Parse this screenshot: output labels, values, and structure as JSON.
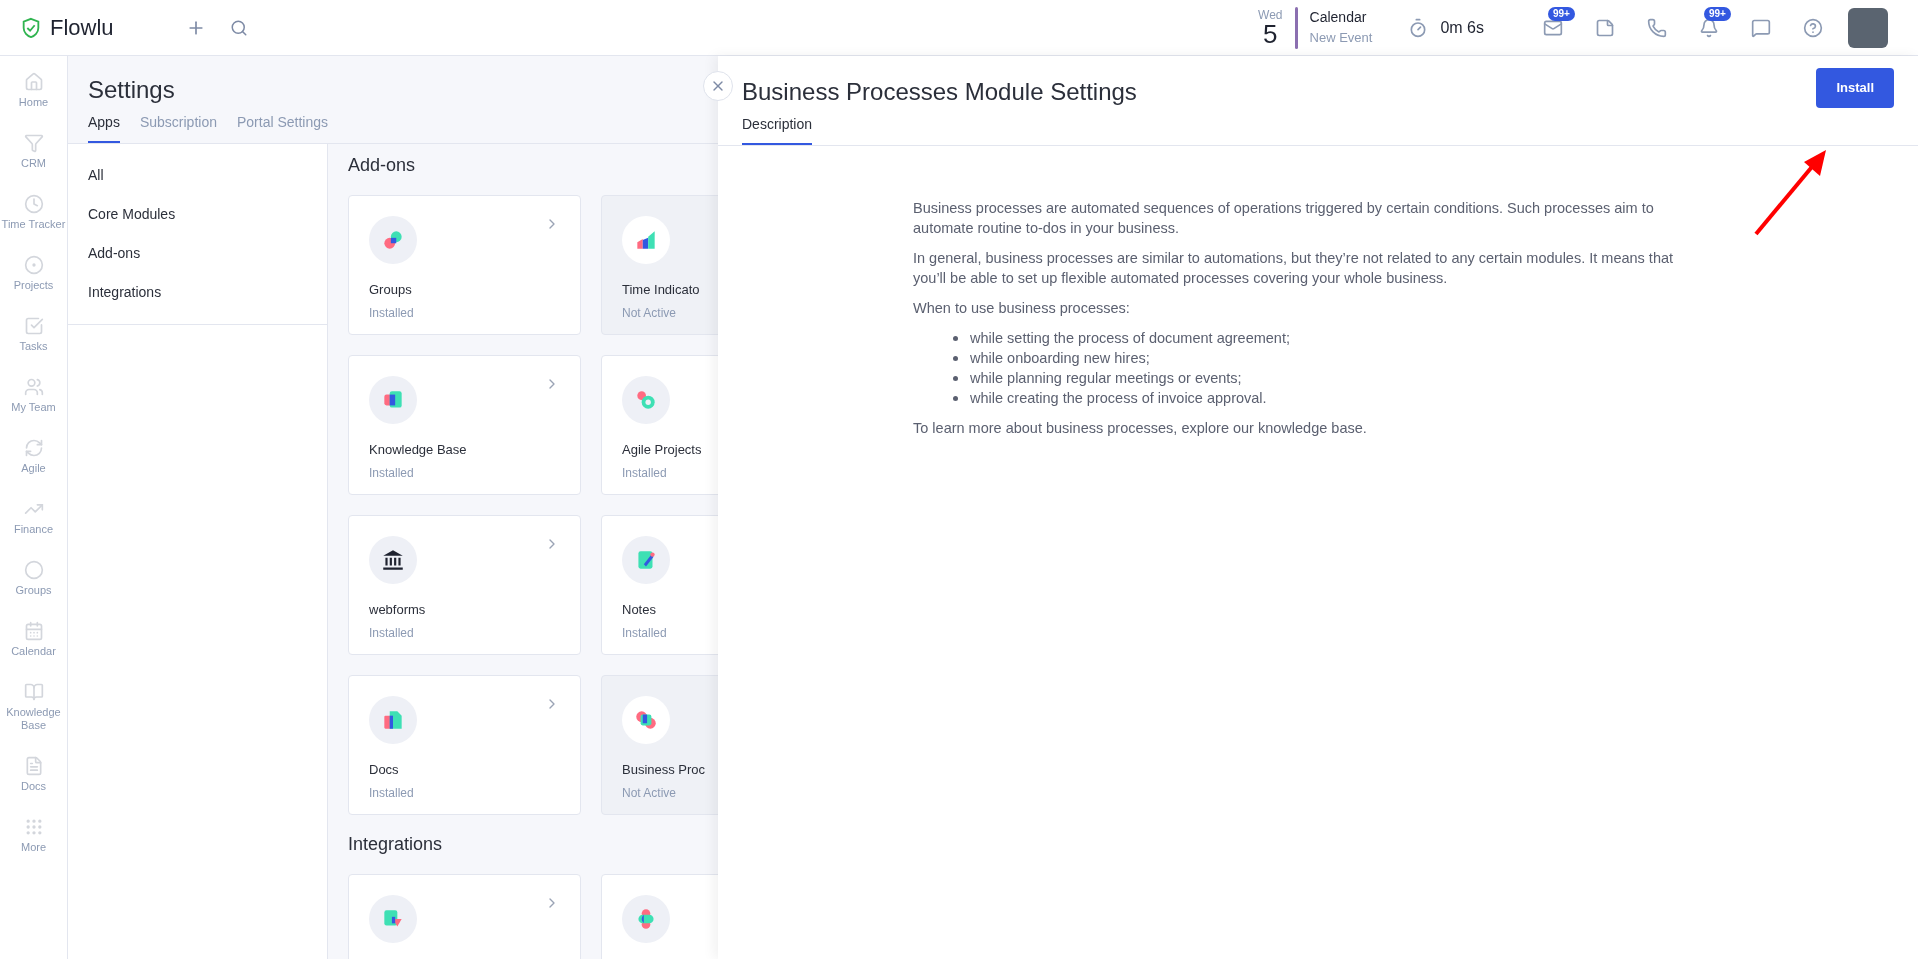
{
  "topbar": {
    "logo": "Flowlu",
    "date": {
      "weekday": "Wed",
      "day": "5"
    },
    "calendar": {
      "title": "Calendar",
      "action": "New Event"
    },
    "timer": "0m 6s",
    "icons": [
      {
        "kind": "mail",
        "badge": "99+"
      },
      {
        "kind": "notes"
      },
      {
        "kind": "phone"
      },
      {
        "kind": "bell",
        "badge": "99+"
      },
      {
        "kind": "chat"
      },
      {
        "kind": "help"
      }
    ]
  },
  "nav": [
    {
      "kind": "home",
      "label": "Home"
    },
    {
      "kind": "crm",
      "label": "CRM"
    },
    {
      "kind": "timer",
      "label": "Time Tracker"
    },
    {
      "kind": "projects",
      "label": "Projects"
    },
    {
      "kind": "tasks",
      "label": "Tasks"
    },
    {
      "kind": "team",
      "label": "My Team"
    },
    {
      "kind": "agile",
      "label": "Agile"
    },
    {
      "kind": "finance",
      "label": "Finance"
    },
    {
      "kind": "groups",
      "label": "Groups"
    },
    {
      "kind": "calendar",
      "label": "Calendar"
    },
    {
      "kind": "kb",
      "label": "Knowledge Base"
    },
    {
      "kind": "docs",
      "label": "Docs"
    },
    {
      "kind": "more",
      "label": "More"
    }
  ],
  "settings": {
    "title": "Settings",
    "tabs": [
      {
        "label": "Apps",
        "selected": true
      },
      {
        "label": "Subscription",
        "selected": false
      },
      {
        "label": "Portal Settings",
        "selected": false
      }
    ],
    "filters": [
      {
        "label": "All"
      },
      {
        "label": "Core Modules"
      },
      {
        "label": "Add-ons"
      },
      {
        "label": "Integrations"
      }
    ],
    "sections": [
      {
        "title": "Add-ons",
        "cards": [
          {
            "kind": "groups",
            "name": "Groups",
            "status": "Installed",
            "active": true
          },
          {
            "kind": "chart",
            "name": "Time Indicato",
            "status": "Not Active",
            "active": false
          },
          {
            "kind": "kb",
            "name": "Knowledge Base",
            "status": "Installed",
            "active": true
          },
          {
            "kind": "agile",
            "name": "Agile Projects",
            "status": "Installed",
            "active": true
          },
          {
            "kind": "bank",
            "name": "webforms",
            "status": "Installed",
            "active": true
          },
          {
            "kind": "note",
            "name": "Notes",
            "status": "Installed",
            "active": true
          },
          {
            "kind": "docs",
            "name": "Docs",
            "status": "Installed",
            "active": true
          },
          {
            "kind": "process",
            "name": "Business Proc",
            "status": "Not Active",
            "active": false
          }
        ]
      },
      {
        "title": "Integrations",
        "cards": [
          {
            "kind": "import",
            "active": true
          },
          {
            "kind": "link",
            "active": true
          }
        ]
      }
    ]
  },
  "drawer": {
    "title": "Business Processes Module Settings",
    "tabs": [
      {
        "label": "Description",
        "selected": true
      }
    ],
    "button": "Install",
    "paragraphs": [
      "Business processes are automated sequences of operations triggered by certain conditions. Such processes aim to automate routine to-dos in your business.",
      "In general, business processes are similar to automations, but they’re not related to any certain modules. It means that you’ll be able to set up flexible automated processes covering your whole business.",
      "When to use business processes:"
    ],
    "bullets": [
      "while setting the process of document agreement;",
      "while onboarding new hires;",
      "while planning regular meetings or events;",
      "while creating the process of invoice approval."
    ],
    "footer": "To learn more about business processes, explore our knowledge base."
  }
}
